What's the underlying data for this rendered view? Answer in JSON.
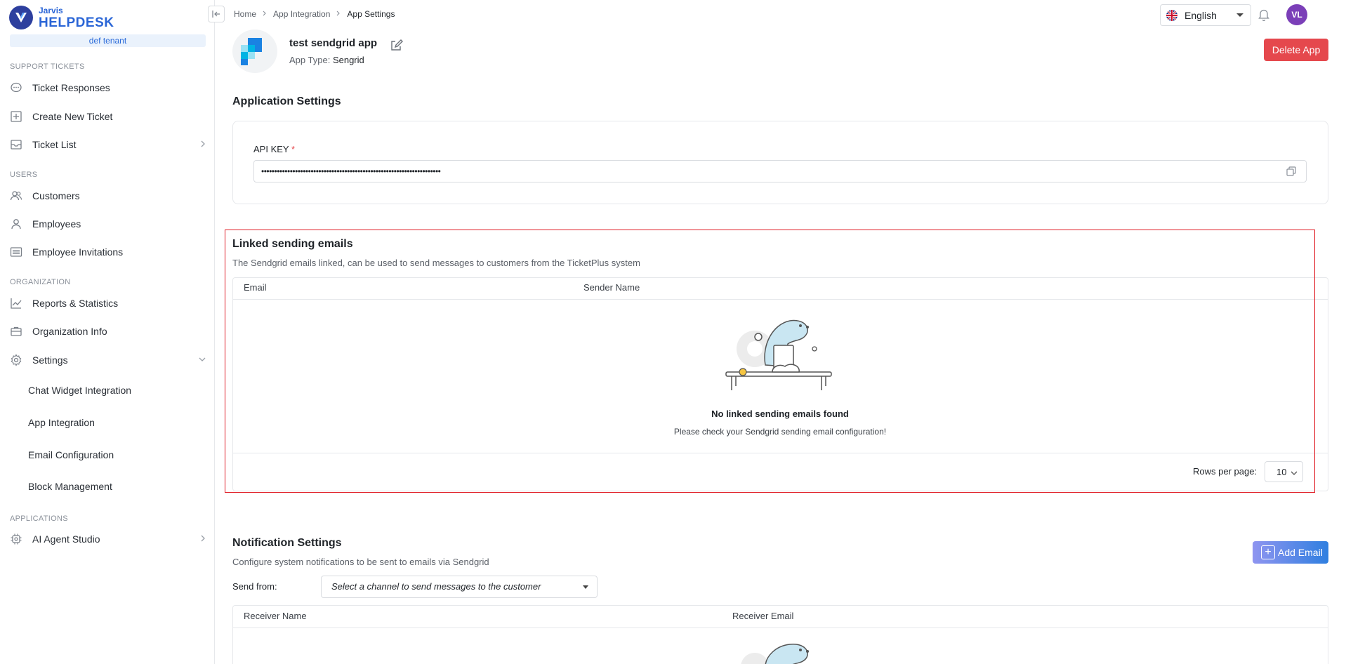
{
  "brand": {
    "small": "Jarvis",
    "big": "HELPDESK",
    "tenant": "def tenant"
  },
  "sidebar": {
    "sections": {
      "support": "SUPPORT TICKETS",
      "users": "USERS",
      "organization": "ORGANIZATION",
      "applications": "APPLICATIONS"
    },
    "items": {
      "ticket_responses": "Ticket Responses",
      "create_ticket": "Create New Ticket",
      "ticket_list": "Ticket List",
      "customers": "Customers",
      "employees": "Employees",
      "employee_invitations": "Employee Invitations",
      "reports": "Reports & Statistics",
      "org_info": "Organization Info",
      "settings": "Settings",
      "chat_widget": "Chat Widget Integration",
      "app_integration": "App Integration",
      "email_config": "Email Configuration",
      "block_mgmt": "Block Management",
      "ai_agent": "AI Agent Studio"
    }
  },
  "header": {
    "breadcrumb": [
      "Home",
      "App Integration",
      "App Settings"
    ],
    "language": "English",
    "avatar_initials": "VL"
  },
  "app": {
    "name": "test sendgrid app",
    "type_label": "App Type:",
    "type_value": "Sengrid",
    "delete_label": "Delete App"
  },
  "application_settings": {
    "title": "Application Settings",
    "api_key_label": "API KEY",
    "api_key_required": "*",
    "api_key_value": "•••••••••••••••••••••••••••••••••••••••••••••••••••••••••••••••••••••"
  },
  "linked_emails": {
    "title": "Linked sending emails",
    "description": "The Sendgrid emails linked, can be used to send messages to customers from the TicketPlus system",
    "columns": [
      "Email",
      "Sender Name"
    ],
    "empty_title": "No linked sending emails found",
    "empty_subtitle": "Please check your Sendgrid sending email configuration!",
    "rows_per_page_label": "Rows per page:",
    "rows_per_page_value": "10"
  },
  "notification_settings": {
    "title": "Notification Settings",
    "description": "Configure system notifications to be sent to emails via Sendgrid",
    "add_email_label": "Add Email",
    "send_from_label": "Send from:",
    "channel_placeholder": "Select a channel to send messages to the customer",
    "columns": [
      "Receiver Name",
      "Receiver Email"
    ]
  },
  "colors": {
    "brand": "#2a65d6",
    "danger": "#e5484d",
    "highlight_border": "#e01b24"
  }
}
